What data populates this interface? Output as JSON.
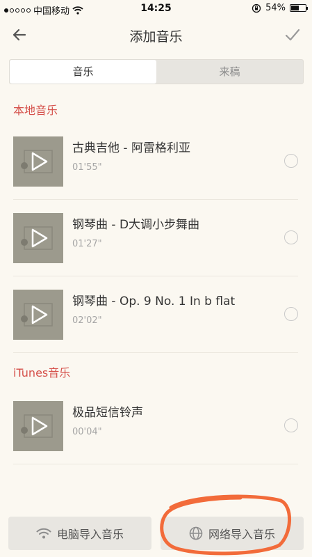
{
  "status_bar": {
    "carrier": "中国移动",
    "time": "14:25",
    "battery_percent": "54%",
    "battery_level": 0.54
  },
  "nav": {
    "title": "添加音乐",
    "back_icon": "arrow-left-icon",
    "confirm_icon": "check-icon"
  },
  "tabs": [
    {
      "label": "音乐",
      "active": true
    },
    {
      "label": "来稿",
      "active": false
    }
  ],
  "sections": [
    {
      "title": "本地音乐",
      "items": [
        {
          "name": "古典吉他 - 阿雷格利亚",
          "duration": "01'55\""
        },
        {
          "name": "钢琴曲 - D大调小步舞曲",
          "duration": "01'27\""
        },
        {
          "name": "钢琴曲 - Op. 9 No. 1 In b flat",
          "duration": "02'02\""
        }
      ]
    },
    {
      "title": "iTunes音乐",
      "items": [
        {
          "name": "极品短信铃声",
          "duration": "00'04\""
        }
      ]
    }
  ],
  "bottom": {
    "computer_import": "电脑导入音乐",
    "network_import": "网络导入音乐"
  },
  "colors": {
    "accent_red": "#d5504a",
    "annotation_orange": "#f26b3a",
    "background": "#fbf8f1"
  }
}
